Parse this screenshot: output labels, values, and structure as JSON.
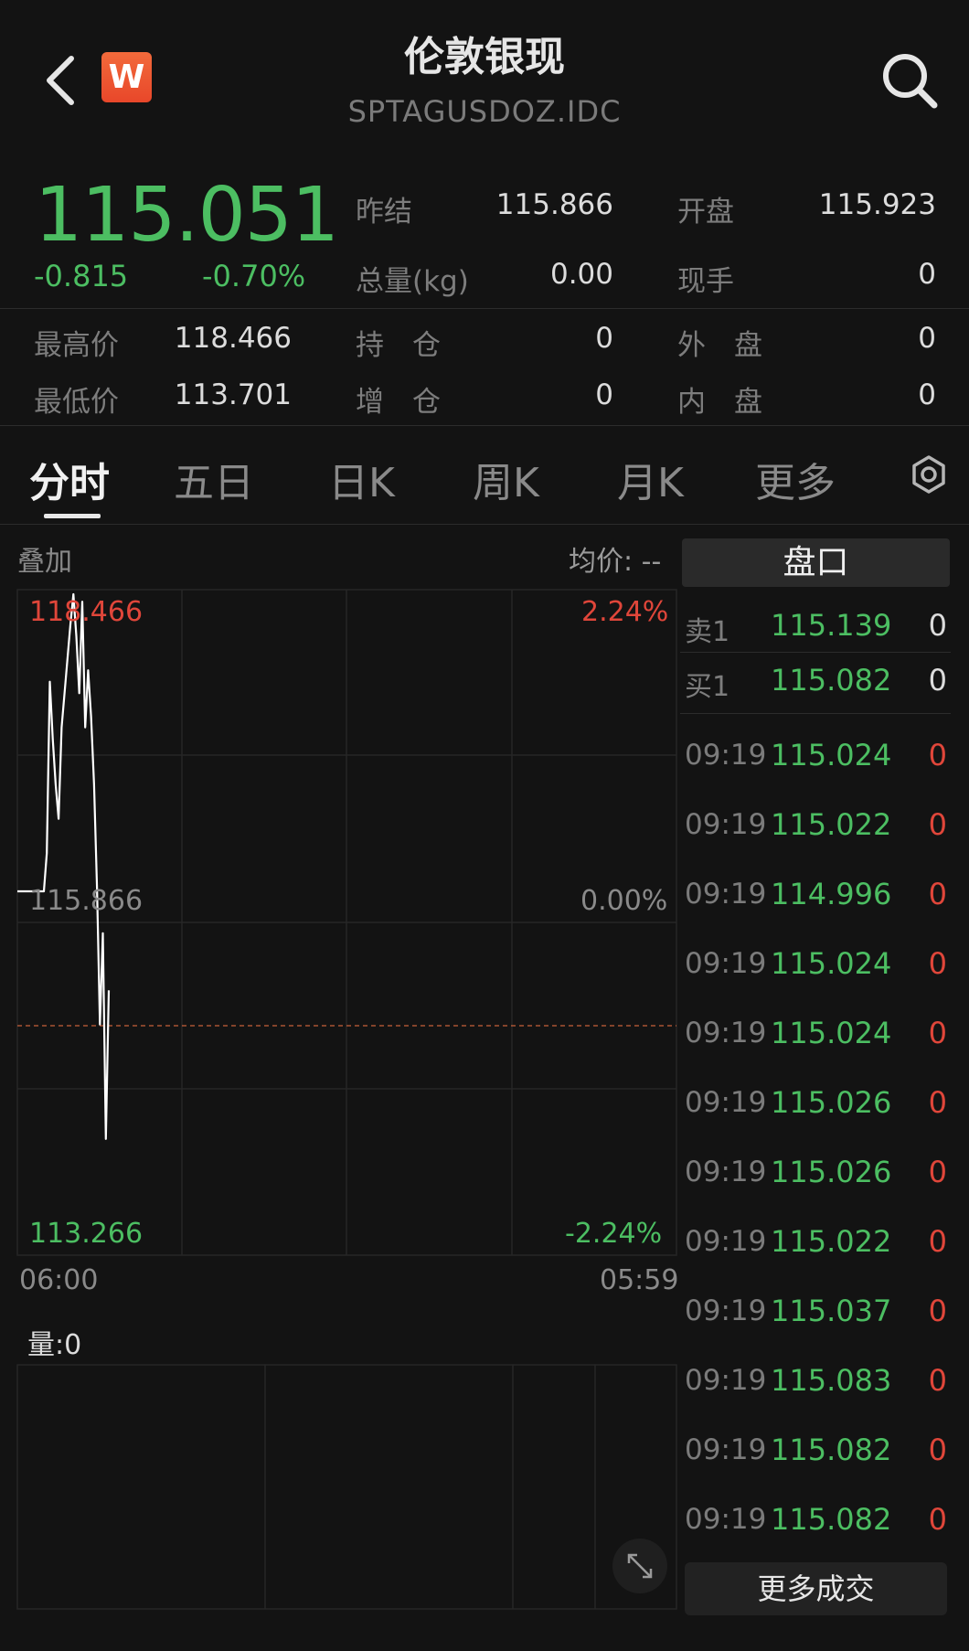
{
  "header": {
    "title": "伦敦银现",
    "subtitle": "SPTAGUSDOZ.IDC",
    "logo_letter": "W"
  },
  "quote": {
    "price": "115.051",
    "change": "-0.815",
    "change_pct": "-0.70%",
    "stats": [
      {
        "label": "昨结",
        "value": "115.866"
      },
      {
        "label": "开盘",
        "value": "115.923"
      },
      {
        "label": "总量(kg)",
        "value": "0.00"
      },
      {
        "label": "现手",
        "value": "0"
      },
      {
        "label": "最高价",
        "value": "118.466"
      },
      {
        "label": "持　仓",
        "value": "0"
      },
      {
        "label": "外　盘",
        "value": "0"
      },
      {
        "label": "最低价",
        "value": "113.701"
      },
      {
        "label": "增　仓",
        "value": "0"
      },
      {
        "label": "内　盘",
        "value": "0"
      }
    ]
  },
  "tabs": [
    "分时",
    "五日",
    "日K",
    "周K",
    "月K",
    "更多"
  ],
  "chart_header": {
    "overlay_label": "叠加",
    "avg_label": "均价: --"
  },
  "chart_labels": {
    "top_price": "118.466",
    "mid_price": "115.866",
    "bottom_price": "113.266",
    "top_pct": "2.24%",
    "mid_pct": "0.00%",
    "bottom_pct": "-2.24%",
    "time_start": "06:00",
    "time_end": "05:59",
    "volume_label": "量:0"
  },
  "chart_data": {
    "type": "line",
    "title": "",
    "xlabel": "",
    "ylabel": "",
    "ylim": [
      113.266,
      118.466
    ],
    "reference": 115.866,
    "x_ticks": [
      "06:00",
      "05:59"
    ],
    "series": [
      {
        "values": [
          115.866,
          115.866,
          115.866,
          115.866,
          116.2,
          117.7,
          117.2,
          116.8,
          116.5,
          117.3,
          117.6,
          117.9,
          118.2,
          118.466,
          118.1,
          117.6,
          118.4,
          117.3,
          117.8,
          117.4,
          116.8,
          115.9,
          114.7,
          115.5,
          113.7,
          115.0
        ]
      }
    ],
    "colors": {
      "line": "#ffffff",
      "reference": "#c7603a"
    }
  },
  "order_book": {
    "tab_label": "盘口",
    "sell": {
      "label": "卖1",
      "price": "115.139",
      "volume": "0"
    },
    "buy": {
      "label": "买1",
      "price": "115.082",
      "volume": "0"
    }
  },
  "trades": [
    {
      "time": "09:19",
      "price": "115.024",
      "volume": "0"
    },
    {
      "time": "09:19",
      "price": "115.022",
      "volume": "0"
    },
    {
      "time": "09:19",
      "price": "114.996",
      "volume": "0"
    },
    {
      "time": "09:19",
      "price": "115.024",
      "volume": "0"
    },
    {
      "time": "09:19",
      "price": "115.024",
      "volume": "0"
    },
    {
      "time": "09:19",
      "price": "115.026",
      "volume": "0"
    },
    {
      "time": "09:19",
      "price": "115.026",
      "volume": "0"
    },
    {
      "time": "09:19",
      "price": "115.022",
      "volume": "0"
    },
    {
      "time": "09:19",
      "price": "115.037",
      "volume": "0"
    },
    {
      "time": "09:19",
      "price": "115.083",
      "volume": "0"
    },
    {
      "time": "09:19",
      "price": "115.082",
      "volume": "0"
    },
    {
      "time": "09:19",
      "price": "115.082",
      "volume": "0"
    }
  ],
  "more_trades_label": "更多成交",
  "colors": {
    "up": "#e0463a",
    "down": "#4cbe62",
    "background": "#131313"
  }
}
